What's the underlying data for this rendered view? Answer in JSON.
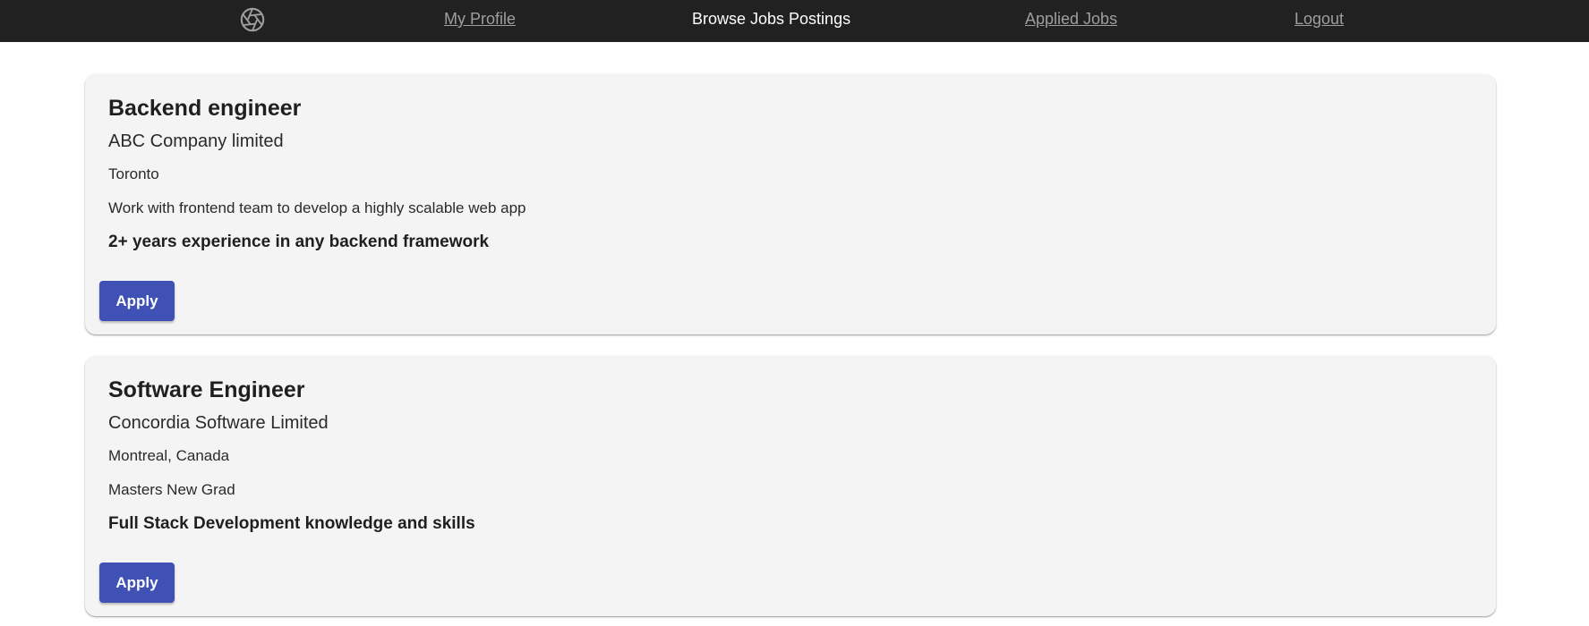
{
  "nav": {
    "logo_icon": "aperture-icon",
    "links": [
      {
        "label": "My Profile",
        "active": false
      },
      {
        "label": "Browse Jobs Postings",
        "active": true
      },
      {
        "label": "Applied Jobs",
        "active": false
      },
      {
        "label": "Logout",
        "active": false
      }
    ]
  },
  "jobs": [
    {
      "title": "Backend engineer",
      "company": "ABC Company limited",
      "location": "Toronto",
      "description": "Work with frontend team to develop a highly scalable web app",
      "requirement": "2+ years experience in any backend framework",
      "apply_label": "Apply"
    },
    {
      "title": "Software Engineer",
      "company": "Concordia Software Limited",
      "location": "Montreal, Canada",
      "description": "Masters New Grad",
      "requirement": "Full Stack Development knowledge and skills",
      "apply_label": "Apply"
    }
  ],
  "colors": {
    "navbar_bg": "#212121",
    "nav_link": "#9e9e9e",
    "nav_link_active": "#ffffff",
    "card_bg": "#f4f4f4",
    "button_bg": "#3f51b5"
  }
}
